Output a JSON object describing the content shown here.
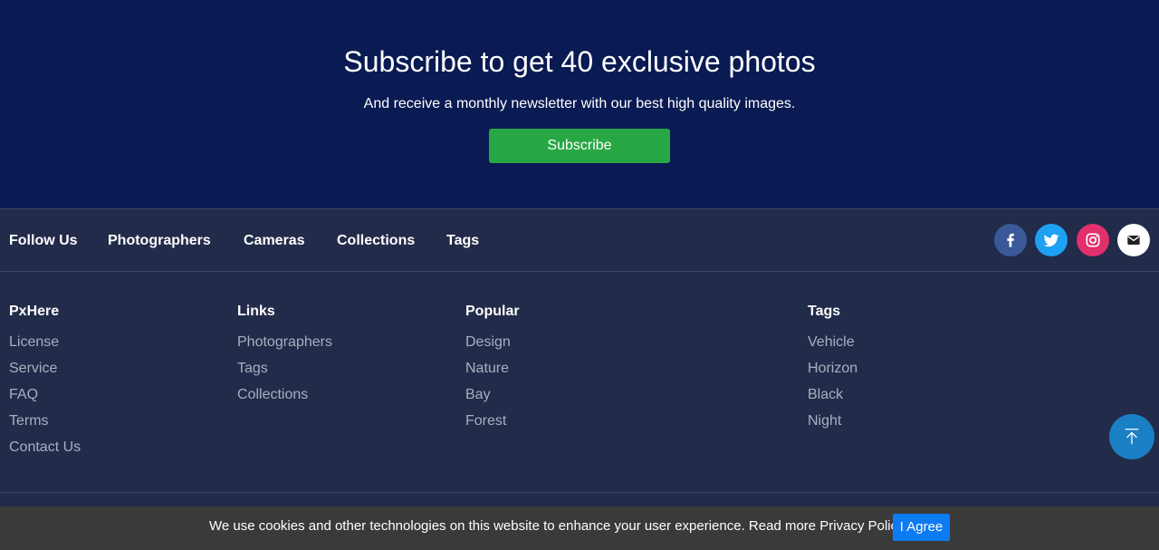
{
  "subscribe": {
    "title": "Subscribe to get 40 exclusive photos",
    "subtitle": "And receive a monthly newsletter with our best high quality images.",
    "button_label": "Subscribe"
  },
  "nav": {
    "items": [
      "Follow Us",
      "Photographers",
      "Cameras",
      "Collections",
      "Tags"
    ],
    "social": [
      {
        "icon": "facebook-icon",
        "color": "#3b5998"
      },
      {
        "icon": "twitter-icon",
        "color": "#1da1f2"
      },
      {
        "icon": "instagram-icon",
        "color": "#e1306c"
      },
      {
        "icon": "email-icon",
        "color": "#ffffff"
      }
    ]
  },
  "columns": [
    {
      "heading": "PxHere",
      "links": [
        "License",
        "Service",
        "FAQ",
        "Terms",
        "Contact Us"
      ]
    },
    {
      "heading": "Links",
      "links": [
        "Photographers",
        "Tags",
        "Collections"
      ]
    },
    {
      "heading": "Popular",
      "links": [
        "Design",
        "Nature",
        "Bay",
        "Forest"
      ]
    },
    {
      "heading": "Tags",
      "links": [
        "Vehicle",
        "Horizon",
        "Black",
        "Night"
      ]
    }
  ],
  "back_to_top": {
    "icon": "arrow-up-to-top-icon"
  },
  "cookie": {
    "text": "We use cookies and other technologies on this website to enhance your user experience. Read more Privacy Policy.",
    "button_label": "I Agree"
  },
  "colors": {
    "subscribe_bg": "#0a1a52",
    "footer_bg": "#222b49",
    "subscribe_button": "#28a745",
    "agree_button": "#0d7bf2",
    "back_to_top": "#1a7fc4"
  }
}
